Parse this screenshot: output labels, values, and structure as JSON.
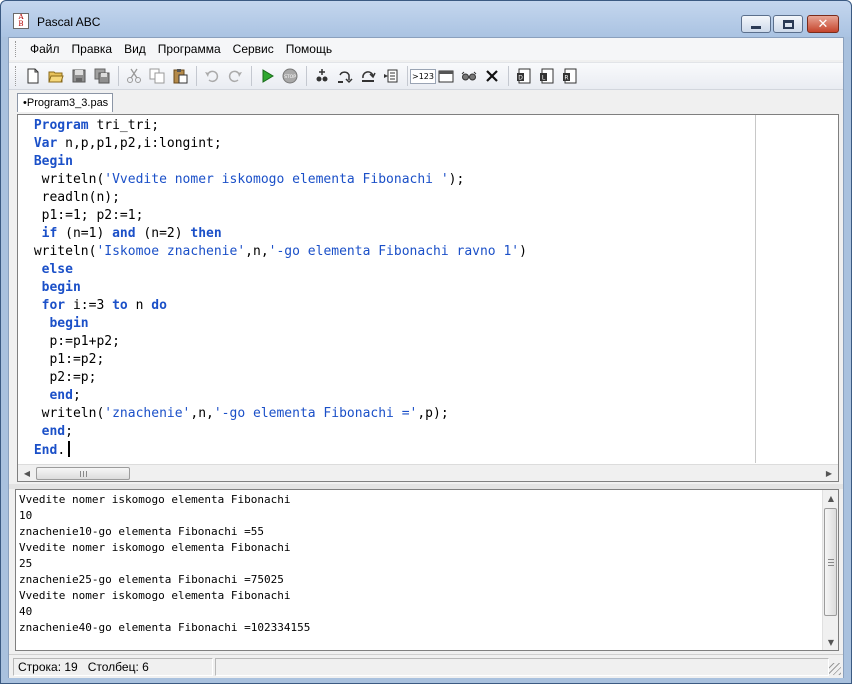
{
  "window": {
    "title": "Pascal ABC",
    "icon_name": "pascal-abc-icon",
    "icon_letters": [
      "A",
      "B",
      "C"
    ]
  },
  "menu": {
    "items": [
      "Файл",
      "Правка",
      "Вид",
      "Программа",
      "Сервис",
      "Помощь"
    ]
  },
  "toolbar": {
    "groups": [
      [
        "new-file-icon",
        "open-folder-icon",
        "save-icon",
        "save-all-icon"
      ],
      [
        "cut-icon",
        "copy-icon",
        "paste-icon"
      ],
      [
        "undo-icon",
        "redo-icon"
      ],
      [
        "run-icon",
        "stop-icon"
      ],
      [
        "add-watch-icon",
        "step-into-icon",
        "step-over-icon",
        "run-to-cursor-icon"
      ],
      [
        "output-format-icon",
        "window-icon",
        "glasses-icon",
        "clear-icon"
      ],
      [
        "compile-icon",
        "compile-library-icon",
        "compile-release-icon"
      ]
    ],
    "output_format_label": ">123"
  },
  "tab": {
    "label": "Program3_3.pas"
  },
  "editor": {
    "lines": [
      [
        {
          "t": " "
        },
        {
          "t": "Program",
          "k": "kw"
        },
        {
          "t": " tri_tri;"
        }
      ],
      [
        {
          "t": " "
        },
        {
          "t": "Var",
          "k": "kw"
        },
        {
          "t": " n,p,p1,p2,i:longint;"
        }
      ],
      [
        {
          "t": " "
        },
        {
          "t": "Begin",
          "k": "kw"
        }
      ],
      [
        {
          "t": "  writeln("
        },
        {
          "t": "'Vvedite nomer iskomogo elementa Fibonachi '",
          "k": "str"
        },
        {
          "t": ");"
        }
      ],
      [
        {
          "t": "  readln(n);"
        }
      ],
      [
        {
          "t": "  p1:=1; p2:=1;"
        }
      ],
      [
        {
          "t": "  "
        },
        {
          "t": "if",
          "k": "kw"
        },
        {
          "t": " (n=1) "
        },
        {
          "t": "and",
          "k": "kw"
        },
        {
          "t": " (n=2) "
        },
        {
          "t": "then",
          "k": "kw"
        }
      ],
      [
        {
          "t": " writeln("
        },
        {
          "t": "'Iskomoe znachenie'",
          "k": "str"
        },
        {
          "t": ",n,"
        },
        {
          "t": "'-go elementa Fibonachi ravno 1'",
          "k": "str"
        },
        {
          "t": ")"
        }
      ],
      [
        {
          "t": "  "
        },
        {
          "t": "else",
          "k": "kw"
        }
      ],
      [
        {
          "t": "  "
        },
        {
          "t": "begin",
          "k": "kw"
        }
      ],
      [
        {
          "t": "  "
        },
        {
          "t": "for",
          "k": "kw"
        },
        {
          "t": " i:=3 "
        },
        {
          "t": "to",
          "k": "kw"
        },
        {
          "t": " n "
        },
        {
          "t": "do",
          "k": "kw"
        }
      ],
      [
        {
          "t": "   "
        },
        {
          "t": "begin",
          "k": "kw"
        }
      ],
      [
        {
          "t": "   p:=p1+p2;"
        }
      ],
      [
        {
          "t": "   p1:=p2;"
        }
      ],
      [
        {
          "t": "   p2:=p;"
        }
      ],
      [
        {
          "t": "   "
        },
        {
          "t": "end",
          "k": "kw"
        },
        {
          "t": ";"
        }
      ],
      [
        {
          "t": "  writeln("
        },
        {
          "t": "'znachenie'",
          "k": "str"
        },
        {
          "t": ",n,"
        },
        {
          "t": "'-go elementa Fibonachi ='",
          "k": "str"
        },
        {
          "t": ",p);"
        }
      ],
      [
        {
          "t": "  "
        },
        {
          "t": "end",
          "k": "kw"
        },
        {
          "t": ";"
        }
      ],
      [
        {
          "t": " "
        },
        {
          "t": "End",
          "k": "kw"
        },
        {
          "t": "."
        }
      ]
    ],
    "cursor_line": 19
  },
  "output": {
    "lines": [
      "Vvedite nomer iskomogo elementa Fibonachi",
      "10",
      "znachenie10-go elementa Fibonachi =55",
      "Vvedite nomer iskomogo elementa Fibonachi",
      "25",
      "znachenie25-go elementa Fibonachi =75025",
      "Vvedite nomer iskomogo elementa Fibonachi",
      "40",
      "znachenie40-go elementa Fibonachi =102334155"
    ]
  },
  "status": {
    "row_label": "Строка: 19",
    "col_label": "Столбец: 6"
  },
  "colors": {
    "keyword": "#1b50c8",
    "title_gradient_top": "#c4d6ee",
    "close_button": "#c5442c"
  }
}
